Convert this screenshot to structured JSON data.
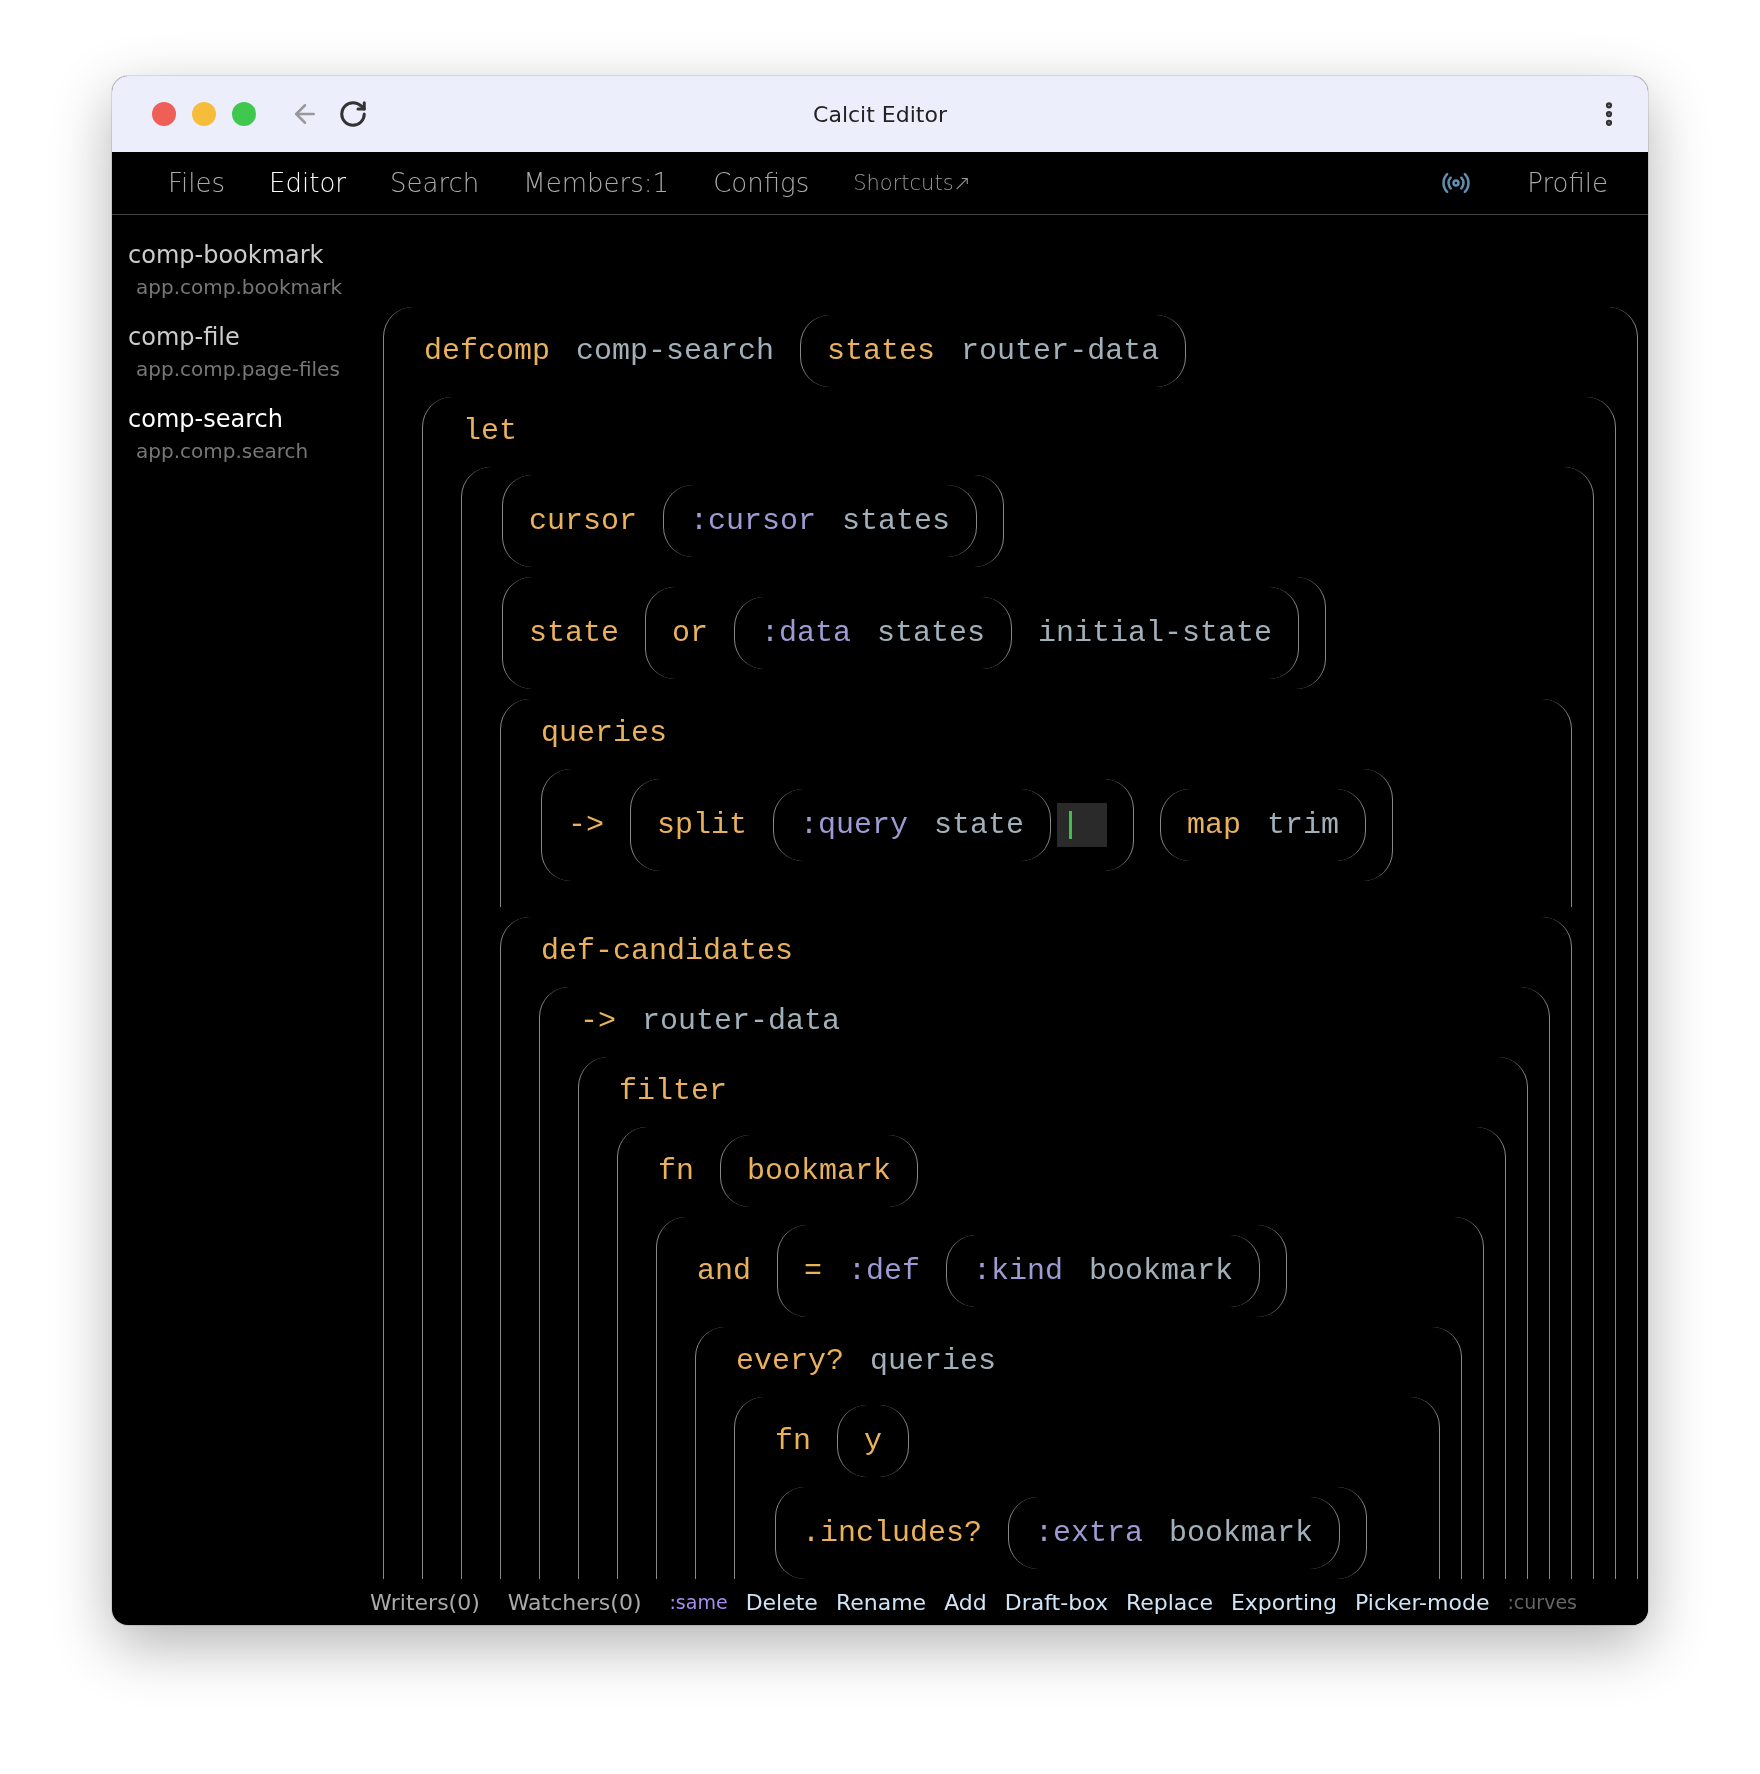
{
  "window": {
    "title": "Calcit Editor"
  },
  "nav": {
    "tabs": [
      {
        "label": "Files",
        "selected": false
      },
      {
        "label": "Editor",
        "selected": true
      },
      {
        "label": "Search",
        "selected": false
      },
      {
        "label": "Members:1",
        "selected": false
      },
      {
        "label": "Configs",
        "selected": false
      }
    ],
    "link": "Shortcuts↗",
    "profile": "Profile"
  },
  "sidebar": {
    "items": [
      {
        "name": "comp-bookmark",
        "ns": "app.comp.bookmark",
        "selected": false
      },
      {
        "name": "comp-file",
        "ns": "app.comp.page-files",
        "selected": false
      },
      {
        "name": "comp-search",
        "ns": "app.comp.search",
        "selected": true
      }
    ]
  },
  "code": {
    "kind": "block",
    "head": [
      {
        "kind": "head",
        "text": "defcomp"
      },
      {
        "kind": "symbol",
        "text": "comp-search"
      },
      {
        "kind": "inline",
        "items": [
          {
            "kind": "head",
            "text": "states"
          },
          {
            "kind": "symbol",
            "text": "router-data"
          }
        ]
      }
    ],
    "body": [
      {
        "kind": "block",
        "head": [
          {
            "kind": "head",
            "text": "let"
          }
        ],
        "body": [
          {
            "kind": "block",
            "body": [
              {
                "kind": "inline",
                "items": [
                  {
                    "kind": "head",
                    "text": "cursor"
                  },
                  {
                    "kind": "inline",
                    "items": [
                      {
                        "kind": "tag",
                        "text": ":cursor"
                      },
                      {
                        "kind": "symbol",
                        "text": "states"
                      }
                    ]
                  }
                ]
              },
              {
                "kind": "inline",
                "items": [
                  {
                    "kind": "head",
                    "text": "state"
                  },
                  {
                    "kind": "inline",
                    "items": [
                      {
                        "kind": "head",
                        "text": "or"
                      },
                      {
                        "kind": "inline",
                        "items": [
                          {
                            "kind": "tag",
                            "text": ":data"
                          },
                          {
                            "kind": "symbol",
                            "text": "states"
                          }
                        ]
                      },
                      {
                        "kind": "symbol",
                        "text": "initial-state"
                      }
                    ]
                  }
                ]
              },
              {
                "kind": "block",
                "head": [
                  {
                    "kind": "head",
                    "text": "queries"
                  }
                ],
                "body": [
                  {
                    "kind": "inline",
                    "items": [
                      {
                        "kind": "head",
                        "text": "->"
                      },
                      {
                        "kind": "inline",
                        "items": [
                          {
                            "kind": "head",
                            "text": "split"
                          },
                          {
                            "kind": "inline",
                            "items": [
                              {
                                "kind": "tag",
                                "text": ":query"
                              },
                              {
                                "kind": "symbol",
                                "text": "state"
                              }
                            ]
                          },
                          {
                            "kind": "cursor"
                          }
                        ]
                      },
                      {
                        "kind": "inline",
                        "items": [
                          {
                            "kind": "head",
                            "text": "map"
                          },
                          {
                            "kind": "symbol",
                            "text": "trim"
                          }
                        ]
                      }
                    ]
                  }
                ]
              },
              {
                "kind": "block",
                "head": [
                  {
                    "kind": "head",
                    "text": "def-candidates"
                  }
                ],
                "body": [
                  {
                    "kind": "block",
                    "head": [
                      {
                        "kind": "head",
                        "text": "->"
                      },
                      {
                        "kind": "symbol",
                        "text": "router-data"
                      }
                    ],
                    "body": [
                      {
                        "kind": "block",
                        "head": [
                          {
                            "kind": "head",
                            "text": "filter"
                          }
                        ],
                        "body": [
                          {
                            "kind": "block",
                            "head": [
                              {
                                "kind": "head",
                                "text": "fn"
                              },
                              {
                                "kind": "inline",
                                "items": [
                                  {
                                    "kind": "head",
                                    "text": "bookmark"
                                  }
                                ]
                              }
                            ],
                            "body": [
                              {
                                "kind": "block",
                                "head": [
                                  {
                                    "kind": "head",
                                    "text": "and"
                                  },
                                  {
                                    "kind": "inline",
                                    "items": [
                                      {
                                        "kind": "head",
                                        "text": "="
                                      },
                                      {
                                        "kind": "tag",
                                        "text": ":def"
                                      },
                                      {
                                        "kind": "inline",
                                        "items": [
                                          {
                                            "kind": "tag",
                                            "text": ":kind"
                                          },
                                          {
                                            "kind": "symbol",
                                            "text": "bookmark"
                                          }
                                        ]
                                      }
                                    ]
                                  }
                                ],
                                "body": [
                                  {
                                    "kind": "block",
                                    "head": [
                                      {
                                        "kind": "head",
                                        "text": "every?"
                                      },
                                      {
                                        "kind": "symbol",
                                        "text": "queries"
                                      }
                                    ],
                                    "body": [
                                      {
                                        "kind": "block",
                                        "head": [
                                          {
                                            "kind": "head",
                                            "text": "fn"
                                          },
                                          {
                                            "kind": "inline",
                                            "items": [
                                              {
                                                "kind": "head",
                                                "text": "y"
                                              }
                                            ]
                                          }
                                        ],
                                        "body": [
                                          {
                                            "kind": "inline",
                                            "items": [
                                              {
                                                "kind": "head",
                                                "text": ".includes?"
                                              },
                                              {
                                                "kind": "inline",
                                                "items": [
                                                  {
                                                    "kind": "tag",
                                                    "text": ":extra"
                                                  },
                                                  {
                                                    "kind": "symbol",
                                                    "text": "bookmark"
                                                  }
                                                ]
                                              }
                                            ]
                                          }
                                        ]
                                      }
                                    ]
                                  }
                                ]
                              }
                            ]
                          }
                        ]
                      }
                    ]
                  }
                ]
              }
            ]
          }
        ]
      }
    ]
  },
  "status_bar": {
    "items": [
      {
        "kind": "info",
        "label": "Writers(0)"
      },
      {
        "kind": "info",
        "label": "Watchers(0)"
      },
      {
        "kind": "tag",
        "label": ":same"
      },
      {
        "kind": "action",
        "label": "Delete"
      },
      {
        "kind": "action",
        "label": "Rename"
      },
      {
        "kind": "action",
        "label": "Add"
      },
      {
        "kind": "action",
        "label": "Draft-box"
      },
      {
        "kind": "action",
        "label": "Replace"
      },
      {
        "kind": "action",
        "label": "Exporting"
      },
      {
        "kind": "action",
        "label": "Picker-mode"
      },
      {
        "kind": "dim",
        "label": ":curves"
      }
    ]
  }
}
